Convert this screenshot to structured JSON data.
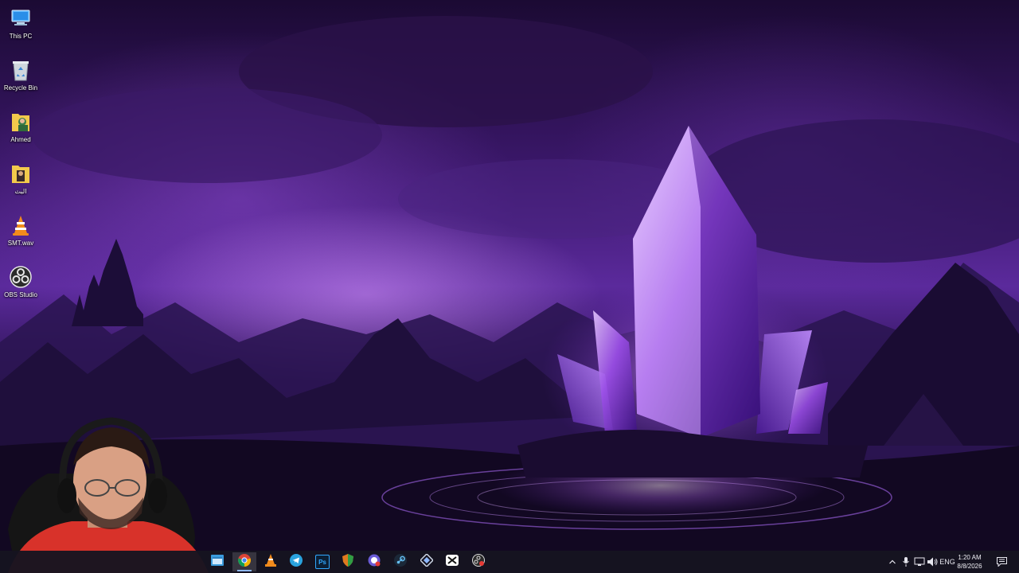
{
  "desktop": {
    "icons": [
      {
        "label": "This PC",
        "icon": "computer-icon"
      },
      {
        "label": "Recycle Bin",
        "icon": "recycle-bin-icon"
      },
      {
        "label": "Ahmed",
        "icon": "user-folder-icon"
      },
      {
        "label": "البث",
        "icon": "folder-icon"
      },
      {
        "label": "SMT.wav",
        "icon": "vlc-cone-icon"
      },
      {
        "label": "OBS Studio",
        "icon": "obs-studio-icon"
      }
    ]
  },
  "taskbar": {
    "apps": [
      {
        "name": "File Explorer",
        "icon": "file-explorer-icon"
      },
      {
        "name": "Google Chrome",
        "icon": "chrome-icon",
        "active": true
      },
      {
        "name": "VLC",
        "icon": "vlc-cone-icon"
      },
      {
        "name": "Telegram",
        "icon": "telegram-icon"
      },
      {
        "name": "Photoshop",
        "icon": "photoshop-icon",
        "text": "Ps"
      },
      {
        "name": "Shield",
        "icon": "shield-icon"
      },
      {
        "name": "Chat",
        "icon": "chat-bubble-icon"
      },
      {
        "name": "Steam",
        "icon": "steam-icon"
      },
      {
        "name": "Diamond app",
        "icon": "diamond-icon"
      },
      {
        "name": "CapCut",
        "icon": "capcut-icon"
      },
      {
        "name": "OBS Recording",
        "icon": "obs-recording-icon"
      }
    ],
    "tray": {
      "language": "ENG",
      "time": "1:20 AM",
      "date": "8/8/2026"
    }
  },
  "colors": {
    "taskbar_bg": "#16141f",
    "accent": "#8fb8ff"
  }
}
